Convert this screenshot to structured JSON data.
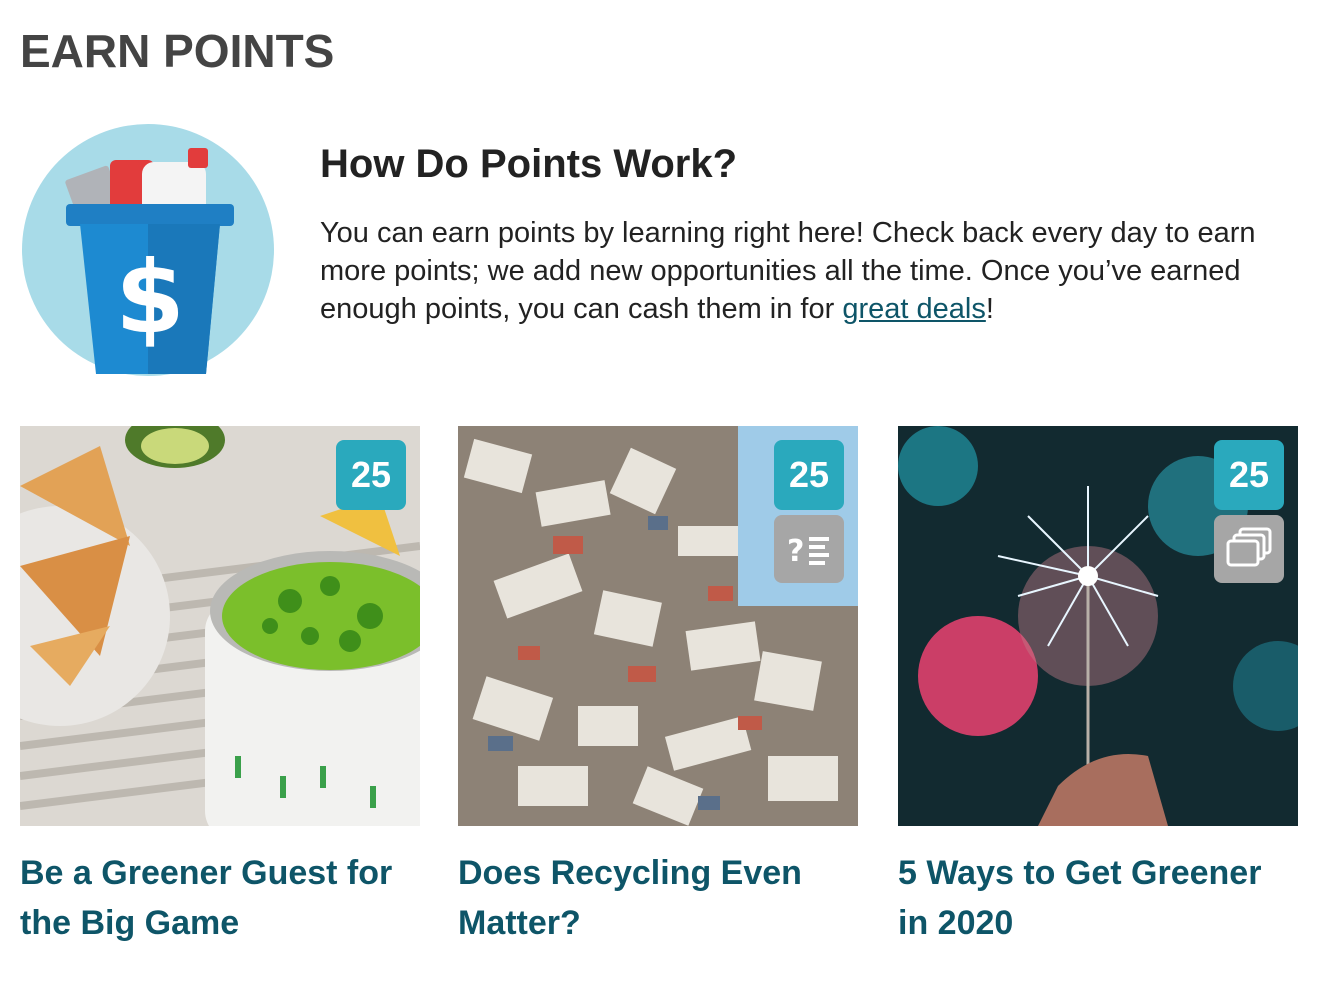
{
  "page": {
    "title": "EARN POINTS"
  },
  "intro": {
    "heading": "How Do Points Work?",
    "text_before_link": "You can earn points by learning right here! Check back every day to earn more points; we add new opportunities all the time. Once you’ve earned enough points, you can cash them in for ",
    "link_label": "great deals",
    "text_after_link": "!",
    "icon": "recycling-bin-dollar-icon"
  },
  "colors": {
    "accent": "#2aa9bd",
    "link": "#0e5568",
    "badge_gray": "#a6a6a6"
  },
  "cards": [
    {
      "points": "25",
      "title": "Be a Greener Guest for the Big Game",
      "type_icon": ""
    },
    {
      "points": "25",
      "title": "Does Recycling Even Matter?",
      "type_icon": "quiz-icon"
    },
    {
      "points": "25",
      "title": "5 Ways to Get Greener in 2020",
      "type_icon": "slideshow-icon"
    }
  ]
}
